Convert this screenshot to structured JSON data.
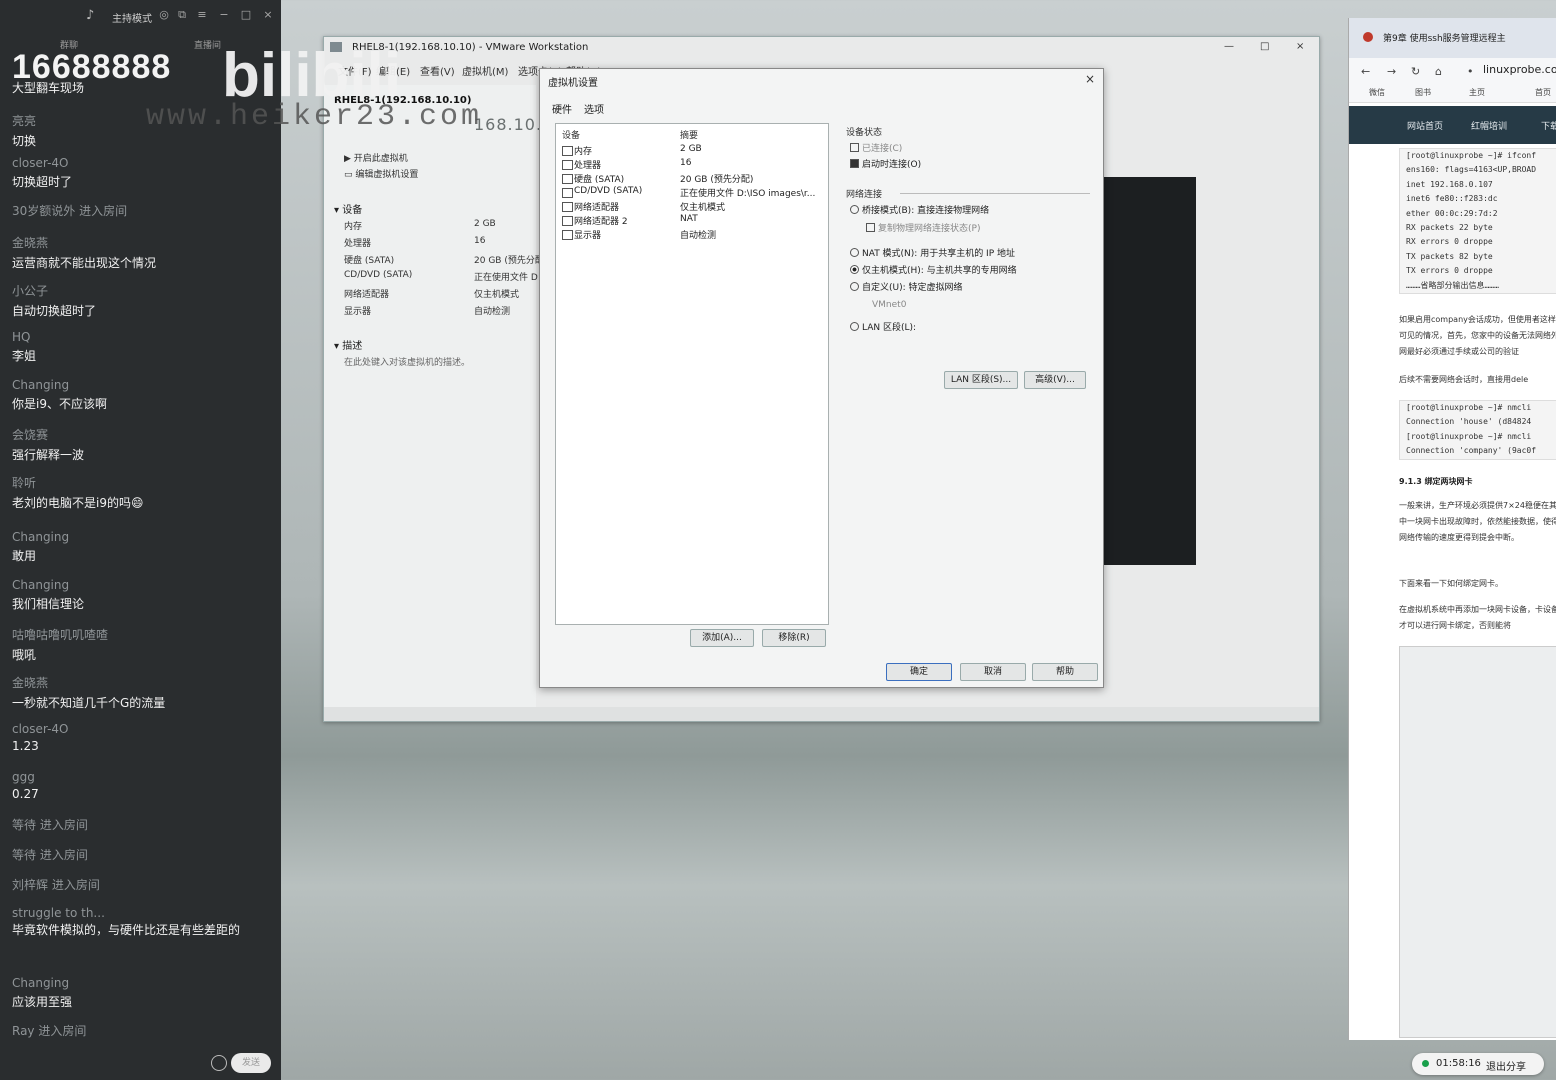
{
  "chat": {
    "mode_label": "主持模式",
    "sub_left": "群聊",
    "sub_right": "直播间",
    "watermark_number": "16688888",
    "messages": [
      {
        "name": "",
        "text": "大型翻车现场",
        "type": "msg"
      },
      {
        "name": "亮亮",
        "text": "切换",
        "type": "msg"
      },
      {
        "name": "closer-4O",
        "text": "切换超时了",
        "type": "msg"
      },
      {
        "name": "",
        "text": "30岁额说外 进入房间",
        "type": "enter"
      },
      {
        "name": "金晓燕",
        "text": "运营商就不能出现这个情况",
        "type": "msg"
      },
      {
        "name": "小公子",
        "text": "自动切换超时了",
        "type": "msg"
      },
      {
        "name": "HQ",
        "text": "李姐",
        "type": "msg"
      },
      {
        "name": "Changing",
        "text": "你是i9、不应该啊",
        "type": "msg"
      },
      {
        "name": "会饶赛",
        "text": "强行解释一波",
        "type": "msg"
      },
      {
        "name": "聆听",
        "text": "老刘的电脑不是i9的吗😄",
        "type": "msg"
      },
      {
        "name": "Changing",
        "text": "敢用",
        "type": "msg"
      },
      {
        "name": "Changing",
        "text": "我们相信理论",
        "type": "msg"
      },
      {
        "name": "咕噜咕噜叽叽喳喳",
        "text": "哦吼",
        "type": "msg"
      },
      {
        "name": "金晓燕",
        "text": "一秒就不知道几千个G的流量",
        "type": "msg"
      },
      {
        "name": "closer-4O",
        "text": "1.23",
        "type": "msg"
      },
      {
        "name": "ggg",
        "text": "0.27",
        "type": "msg"
      },
      {
        "name": "",
        "text": "等待 进入房间",
        "type": "enter"
      },
      {
        "name": "",
        "text": "等待 进入房间",
        "type": "enter"
      },
      {
        "name": "",
        "text": "刘梓辉 进入房间",
        "type": "enter"
      },
      {
        "name": "struggle to th...",
        "text": "毕竟软件模拟的，与硬件比还是有些差距的",
        "type": "msg"
      },
      {
        "name": "Changing",
        "text": "应该用至强",
        "type": "msg"
      },
      {
        "name": "",
        "text": "Ray 进入房间",
        "type": "enter"
      }
    ],
    "send_label": "发送"
  },
  "watermark": {
    "logo": "bilibili",
    "site": "www.heiker23.com"
  },
  "vmware": {
    "title": "RHEL8-1(192.168.10.10) - VMware Workstation",
    "menus": [
      "文件(F)",
      "编辑(E)",
      "查看(V)",
      "虚拟机(M)",
      "选项卡(T)",
      "帮助(H)"
    ],
    "vm_name": "RHEL8-1(192.168.10.10)",
    "vm_sub": "168.10.10",
    "actions": [
      "开启此虚拟机",
      "编辑虚拟机设置"
    ],
    "devices_header": "设备",
    "devices": [
      {
        "name": "内存",
        "value": "2 GB"
      },
      {
        "name": "处理器",
        "value": "16"
      },
      {
        "name": "硬盘 (SATA)",
        "value": "20 GB (预先分配)"
      },
      {
        "name": "CD/DVD (SATA)",
        "value": "正在使用文件 D"
      },
      {
        "name": "网络适配器",
        "value": "仅主机模式"
      },
      {
        "name": "显示器",
        "value": "自动检测"
      }
    ],
    "desc_header": "描述",
    "desc_text": "在此处键入对该虚拟机的描述。"
  },
  "dialog": {
    "title": "虚拟机设置",
    "tabs": [
      "硬件",
      "选项"
    ],
    "col_device": "设备",
    "col_summary": "摘要",
    "rows": [
      {
        "name": "内存",
        "summary": "2 GB"
      },
      {
        "name": "处理器",
        "summary": "16"
      },
      {
        "name": "硬盘 (SATA)",
        "summary": "20 GB (预先分配)"
      },
      {
        "name": "CD/DVD (SATA)",
        "summary": "正在使用文件 D:\\ISO images\\r..."
      },
      {
        "name": "网络适配器",
        "summary": "仅主机模式"
      },
      {
        "name": "网络适配器 2",
        "summary": "NAT"
      },
      {
        "name": "显示器",
        "summary": "自动检测"
      }
    ],
    "add_label": "添加(A)...",
    "remove_label": "移除(R)",
    "status_group": "设备状态",
    "connected": "已连接(C)",
    "connect_on_power": "启动时连接(O)",
    "net_group": "网络连接",
    "bridged": "桥接模式(B): 直接连接物理网络",
    "replicate": "复制物理网络连接状态(P)",
    "nat": "NAT 模式(N): 用于共享主机的 IP 地址",
    "host_only": "仅主机模式(H): 与主机共享的专用网络",
    "custom": "自定义(U): 特定虚拟网络",
    "vmnet": "VMnet0",
    "lan": "LAN 区段(L):",
    "lan_btn": "LAN 区段(S)...",
    "adv_btn": "高级(V)...",
    "ok": "确定",
    "cancel": "取消",
    "help": "帮助"
  },
  "browser": {
    "tab_title": "第9章 使用ssh服务管理远程主",
    "url": "linuxprobe.com",
    "bookmarks": [
      "微信",
      "图书",
      "主页",
      "首页"
    ],
    "nav": [
      "网站首页",
      "红帽培训",
      "下载"
    ],
    "code1": [
      "[root@linuxprobe ~]# ifconf",
      "ens160: flags=4163<UP,BROAD",
      "        inet 192.168.0.107",
      "        inet6 fe80::f283:dc",
      "        ether 00:0c:29:7d:2",
      "        RX packets 22  byte",
      "        RX errors 0  droppe",
      "        TX packets 82  byte",
      "        TX errors 0  droppe",
      "………省略部分输出信息………"
    ],
    "para1": "如果启用company会话成功，但使用者这样可见的情况，首先，您家中的设备无法网络外网最好必须通过手续或公司的验证",
    "para2": "后续不需要网络会话时，直接用dele",
    "code2": [
      "[root@linuxprobe ~]# nmcli",
      "Connection 'house' (d84824",
      "[root@linuxprobe ~]# nmcli",
      "Connection 'company' (9ac0f"
    ],
    "h3": "9.1.3 绑定两块网卡",
    "para3": "一般来讲，生产环境必须提供7×24稳便在其中一块网卡出现故障时，依然能接数据，使得网络传输的速度更得到提会中断。",
    "para4": "下面来看一下如何绑定网卡。",
    "para5": "在虚拟机系统中再添加一块网卡设备，卡设备才可以进行网卡绑定，否则能将"
  },
  "share": {
    "time": "01:58:16",
    "stop": "退出分享"
  }
}
